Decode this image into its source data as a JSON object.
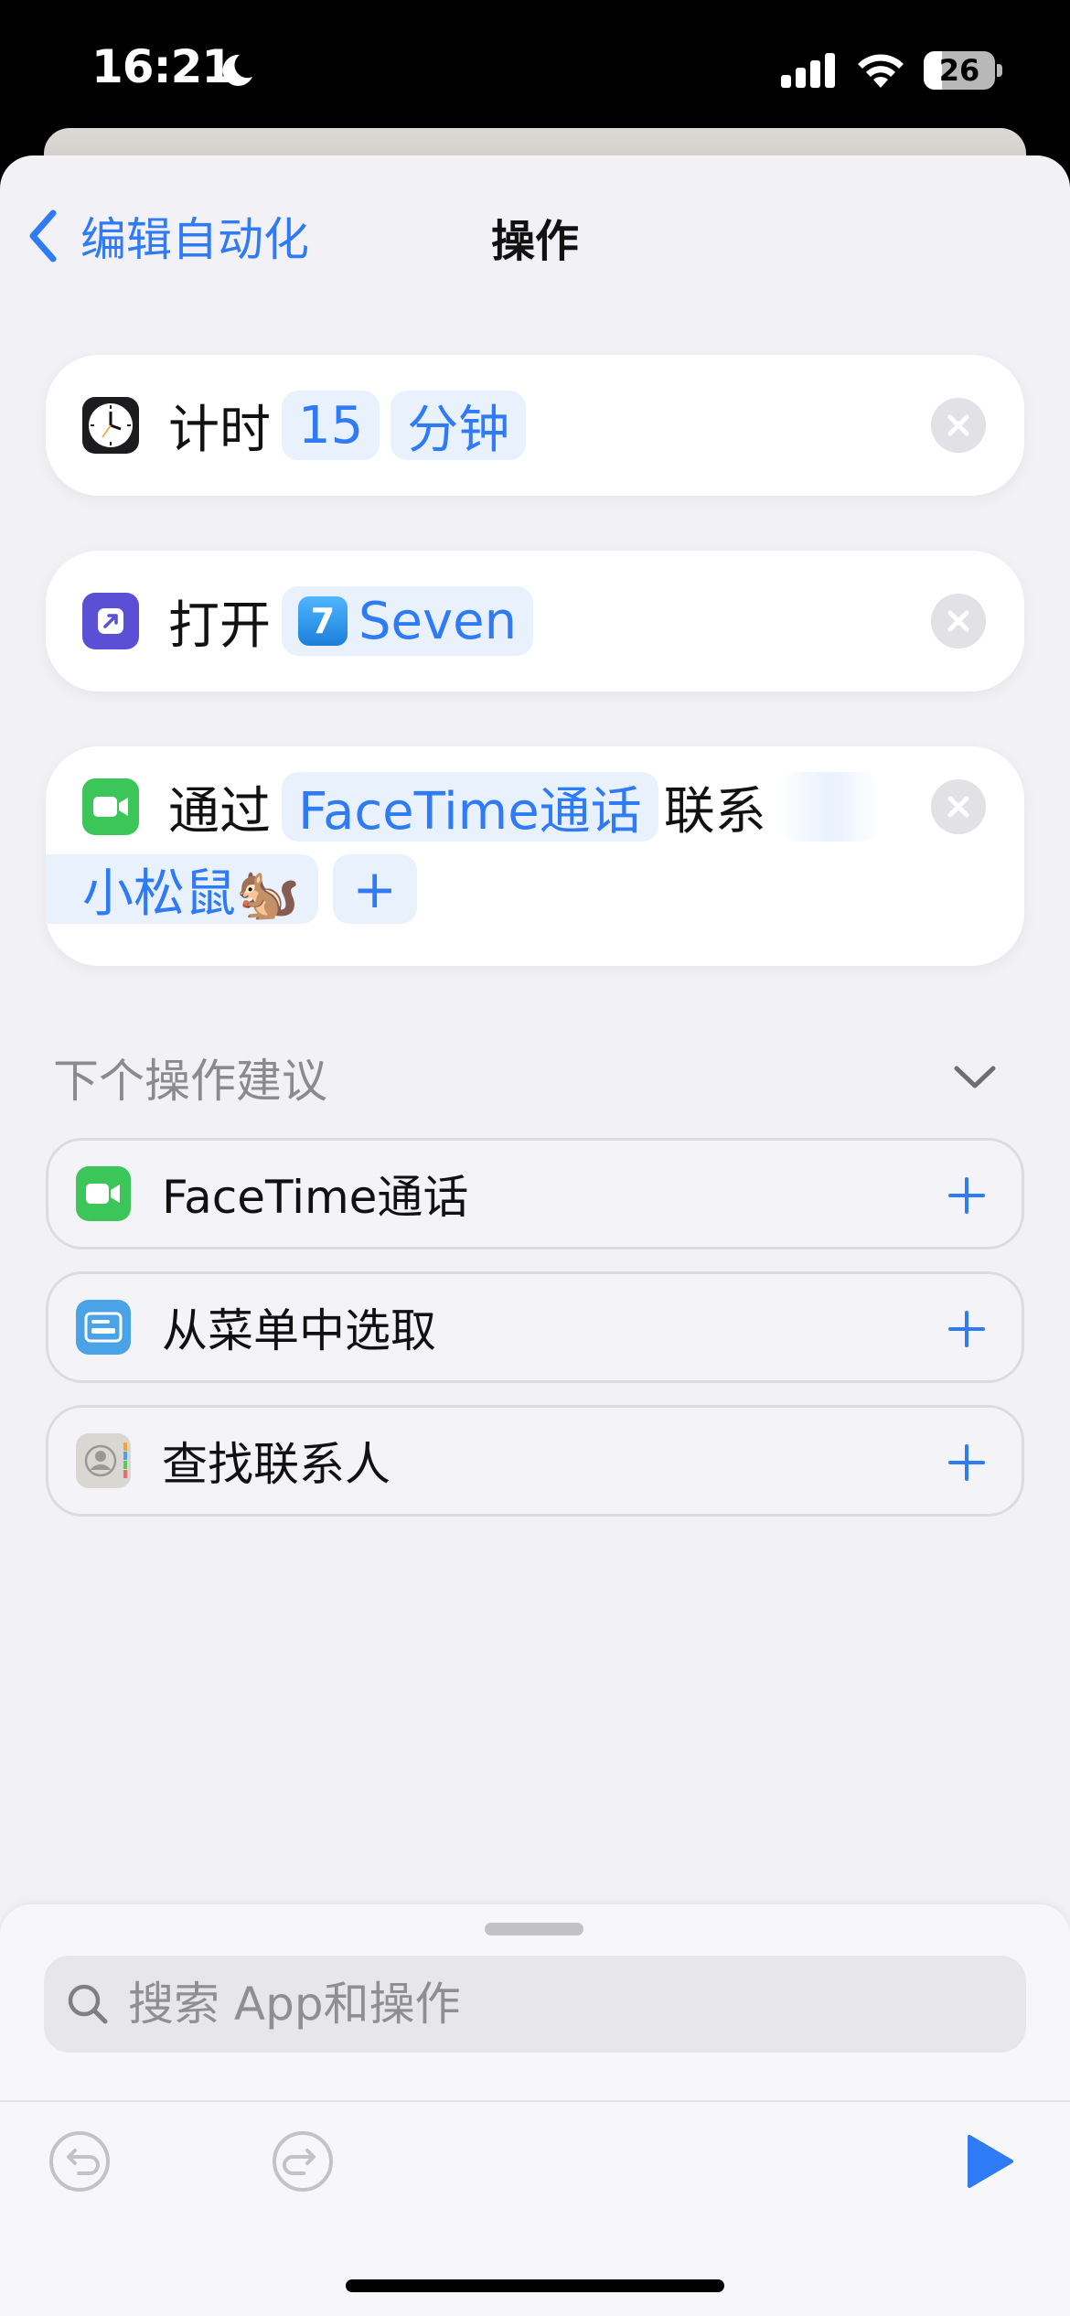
{
  "status_bar": {
    "time": "16:21",
    "battery": "26",
    "battery_level": 0.26
  },
  "nav": {
    "back_label": "编辑自动化",
    "title": "操作"
  },
  "actions": [
    {
      "prefix": "计时",
      "tokens": [
        "15",
        "分钟"
      ],
      "icon": "clock-icon"
    },
    {
      "prefix": "打开",
      "app_badge": "7",
      "app_name": "Seven",
      "icon": "open-app-icon"
    },
    {
      "prefix": "通过",
      "token1": "FaceTime通话",
      "middle": "联系",
      "contact": "小松鼠🐿️",
      "add": "+",
      "icon": "facetime-icon"
    }
  ],
  "suggestions": {
    "header": "下个操作建议",
    "items": [
      {
        "label": "FaceTime通话",
        "icon": "facetime-icon"
      },
      {
        "label": "从菜单中选取",
        "icon": "menu-icon"
      },
      {
        "label": "查找联系人",
        "icon": "contacts-icon"
      }
    ]
  },
  "search": {
    "placeholder": "搜索 App和操作"
  },
  "colors": {
    "accent": "#2f7bf5",
    "background": "#f1f1f6",
    "token_bg": "#e9f1fd"
  }
}
